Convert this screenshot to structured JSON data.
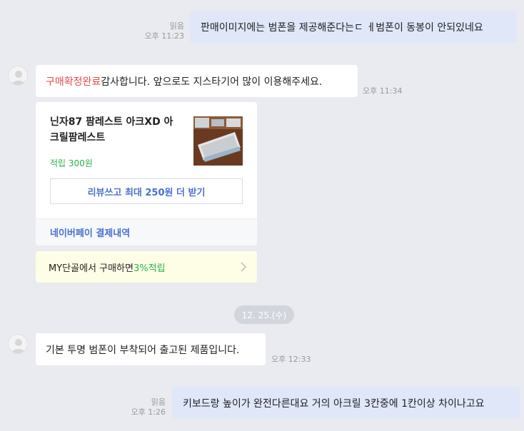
{
  "messages": {
    "m1": {
      "read": "읽음",
      "time": "오후 11:23",
      "text": "판매이미지에는 범폰을 제공해준다는ㄷ  ㅔ범폰이 동봉이 안되있네요"
    },
    "m2": {
      "highlight": "구매확정완료",
      "text": " 감사합니다. 앞으로도 지스타기어 많이 이용해주세요.",
      "time": "오후 11:34"
    },
    "m3": {
      "text": "기본 투명 범폰이 부착되어 출고된 제품입니다.",
      "time": "오후 12:33"
    },
    "m4": {
      "read": "읽음",
      "time": "오후 1:26",
      "text": "키보드랑 높이가 완전다른대요 거의 아크릴 3칸중에 1칸이상 차이나고요"
    }
  },
  "product_card": {
    "title": "닌자87 팜레스트 아크XD 아크릴팜레스트",
    "points": "적립 300원",
    "review_button": "리뷰쓰고 최대 250원 더 받기",
    "payment_link": "네이버페이 결제내역"
  },
  "promo": {
    "text": "MY단골에서 구매하면 ",
    "highlight": "3%적립"
  },
  "date_divider": "12. 25.(수)",
  "colors": {
    "accent_red": "#e94a4a",
    "accent_green": "#27b24a",
    "accent_blue": "#4a6fcf",
    "bubble_me": "#dfe7f9"
  }
}
